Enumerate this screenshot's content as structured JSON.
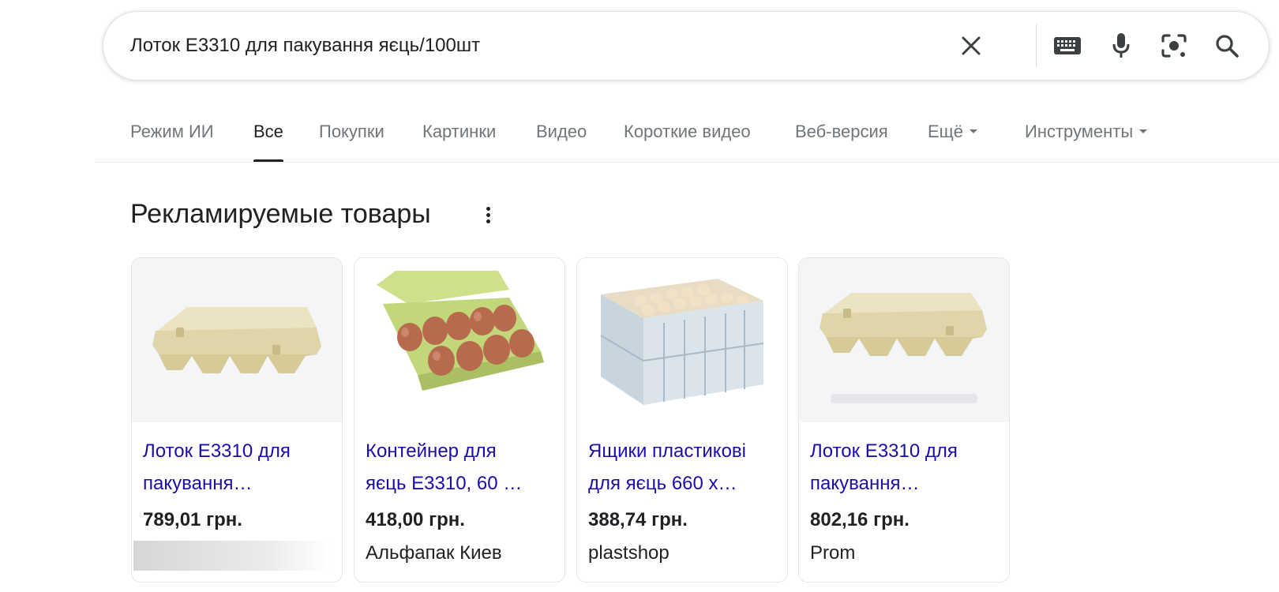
{
  "search": {
    "query": "Лоток Е3310 для пакування яєць/100шт",
    "clear_icon": "close-icon",
    "keyboard_icon": "keyboard-icon",
    "mic_icon": "mic-icon",
    "lens_icon": "camera-lens-icon",
    "search_icon": "search-icon"
  },
  "tabs": [
    {
      "label": "Режим ИИ",
      "active": false
    },
    {
      "label": "Все",
      "active": true
    },
    {
      "label": "Покупки",
      "active": false
    },
    {
      "label": "Картинки",
      "active": false
    },
    {
      "label": "Видео",
      "active": false
    },
    {
      "label": "Короткие видео",
      "active": false
    },
    {
      "label": "Веб-версия",
      "active": false
    },
    {
      "label": "Ещё",
      "active": false,
      "dropdown": true
    },
    {
      "label": "Инструменты",
      "active": false,
      "dropdown": true
    }
  ],
  "section": {
    "title": "Рекламируемые товары",
    "menu_icon": "more-vertical-icon"
  },
  "products": [
    {
      "title_line1": "Лоток Е3310 для",
      "title_line2": "пакування…",
      "price": "789,01 грн.",
      "seller": "",
      "image": "egg-carton-closed"
    },
    {
      "title_line1": "Контейнер для",
      "title_line2": "яєць Е3310, 60 …",
      "price": "418,00 грн.",
      "seller": "Альфапак Киев",
      "image": "egg-carton-open"
    },
    {
      "title_line1": "Ящики пластикові",
      "title_line2": "для яєць 660 х…",
      "price": "388,74 грн.",
      "seller": "plastshop",
      "image": "egg-crates"
    },
    {
      "title_line1": "Лоток Е3310 для",
      "title_line2": "пакування…",
      "price": "802,16 грн.",
      "seller": "Prom",
      "image": "egg-carton-closed"
    }
  ],
  "colors": {
    "link": "#1a0dab",
    "text": "#202124",
    "muted": "#70757a",
    "carton": "#e3d9b0"
  }
}
